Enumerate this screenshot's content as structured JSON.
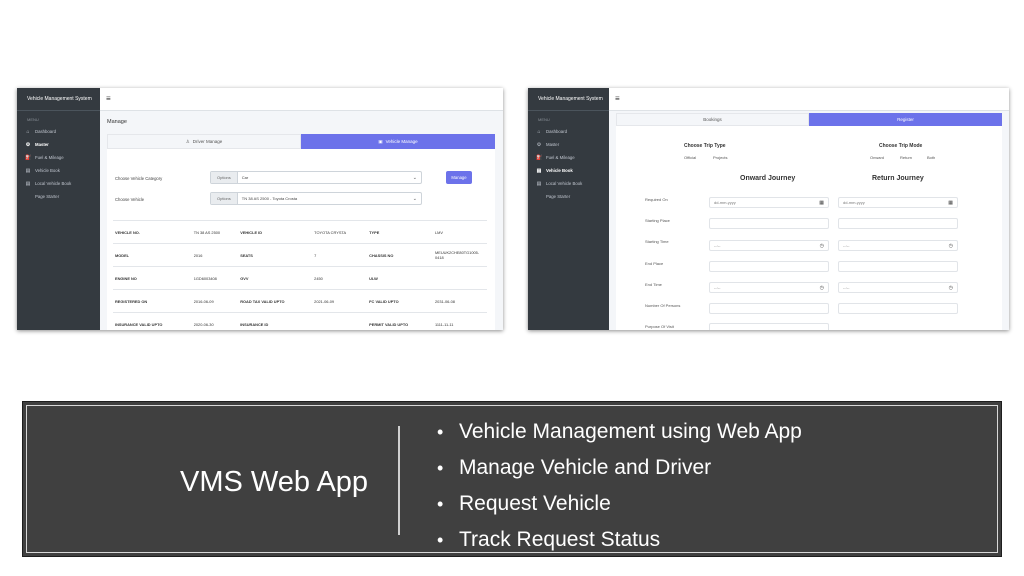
{
  "left_screen": {
    "brand": "Vehicle Management System",
    "menu_heading": "MENU",
    "nav": [
      {
        "icon": "⌂",
        "label": "Dashboard"
      },
      {
        "icon": "⚙",
        "label": "Master"
      },
      {
        "icon": "⛽",
        "label": "Fuel & Mileage"
      },
      {
        "icon": "▤",
        "label": "Vehicle Book"
      },
      {
        "icon": "▤",
        "label": "Local Vehicle Book"
      },
      {
        "icon": "",
        "label": "Page Starter"
      }
    ],
    "page_title": "Manage",
    "tabs": {
      "driver": "Driver Manage",
      "vehicle": "Vehicle Manage",
      "driver_icon": "person-icon",
      "vehicle_icon": "car-icon"
    },
    "form": {
      "category_label": "Choose Vehicle Category",
      "category_addon": "Options",
      "category_value": "Car",
      "vehicle_label": "Choose Vehicle",
      "vehicle_addon": "Options",
      "vehicle_value": "TN 38 AS 2500 - Toyota Crosta",
      "manage_button": "Manage"
    },
    "details": [
      [
        "VEHICLE NO.",
        "TN 38 AS 2500",
        "VEHICLE ID",
        "TOYOTA CRYSTA",
        "TYPE",
        "LMV"
      ],
      [
        "MODEL",
        "2016",
        "SEATS",
        "7",
        "CHASSIS NO",
        "MEUUK2CHE80TG1005-0418"
      ],
      [
        "ENGINE NO",
        "1GD6003408",
        "GVV",
        "2450",
        "ULW",
        ""
      ],
      [
        "REGISTERED ON",
        "2016-06-09",
        "ROAD TAX VALID UPTO",
        "2021-06-09",
        "FC VALID UPTO",
        "2031-06-08"
      ],
      [
        "INSURANCE VALID UPTO",
        "2020-06-30",
        "INSURANCE ID",
        "",
        "PERMIT VALID UPTO",
        "1111-11-11"
      ]
    ]
  },
  "right_screen": {
    "brand": "Vehicle Management System",
    "menu_heading": "MENU",
    "nav": [
      {
        "icon": "⌂",
        "label": "Dashboard"
      },
      {
        "icon": "⚙",
        "label": "Master"
      },
      {
        "icon": "⛽",
        "label": "Fuel & Mileage"
      },
      {
        "icon": "▤",
        "label": "Vehicle Book"
      },
      {
        "icon": "▤",
        "label": "Local Vehicle Book"
      },
      {
        "icon": "",
        "label": "Page Starter"
      }
    ],
    "tabs": {
      "bookings": "Bookings",
      "register": "Register"
    },
    "trip_type": {
      "title": "Choose Trip Type",
      "opt1": "Official",
      "opt2": "Projects"
    },
    "trip_mode": {
      "title": "Choose Trip Mode",
      "opt1": "Onward",
      "opt2": "Return",
      "opt3": "Both"
    },
    "onward_title": "Onward Journey",
    "return_title": "Return Journey",
    "fields": {
      "required_on": "Required On",
      "starting_place": "Starting Place",
      "starting_time": "Starting Time",
      "end_place": "End Place",
      "end_time": "End Time",
      "persons": "Number Of Persons",
      "purpose": "Purpose Of Visit"
    },
    "date_placeholder": "dd-mm-yyyy",
    "time_placeholder": "--:--"
  },
  "banner": {
    "app_name": "VMS Web App",
    "bullets": [
      "Vehicle Management using Web App",
      "Manage Vehicle and Driver",
      "Request Vehicle",
      "Track Request Status"
    ]
  },
  "colors": {
    "accent": "#6c72ea",
    "sidebar": "#343a40",
    "banner_bg": "#404040"
  }
}
